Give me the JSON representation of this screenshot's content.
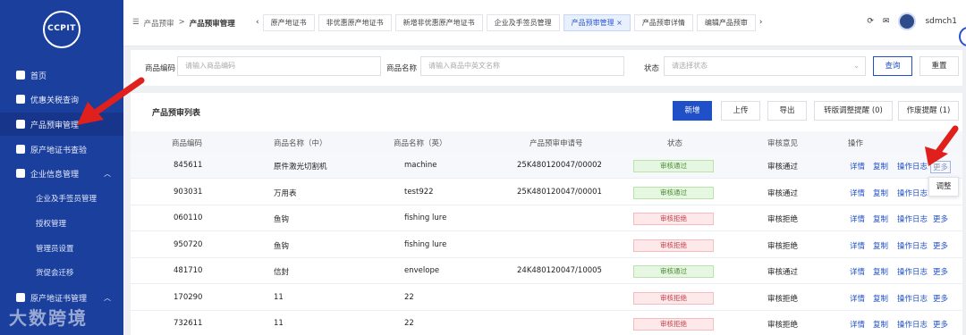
{
  "sidebar": {
    "logo_text": "CCPIT",
    "items": [
      {
        "label": "首页"
      },
      {
        "label": "优惠关税查询"
      },
      {
        "label": "产品预审管理"
      },
      {
        "label": "原产地证书查验"
      },
      {
        "label": "企业信息管理"
      },
      {
        "label": "原产地证书管理"
      }
    ],
    "sub_items": [
      "企业及手签员管理",
      "授权管理",
      "管理员设置",
      "货促会迁移"
    ]
  },
  "topbar": {
    "breadcrumb_root": "产品预审",
    "breadcrumb_sep": ">",
    "breadcrumb_current": "产品预审管理",
    "tabs": [
      "原产地证书",
      "非优惠原产地证书",
      "新增非优惠原产地证书",
      "企业及手签员管理",
      "产品预审管理",
      "产品预审详情",
      "编辑产品预审"
    ],
    "active_tab_close": "×",
    "user_name": "sdmch1"
  },
  "search": {
    "code_label": "商品编码",
    "code_placeholder": "请输入商品编码",
    "name_label": "商品名称",
    "name_placeholder": "请输入商品中英文名称",
    "status_label": "状态",
    "status_placeholder": "请选择状态",
    "query_button": "查询",
    "reset_button": "重置"
  },
  "table": {
    "title": "产品预审列表",
    "buttons": {
      "add": "新增",
      "upload": "上传",
      "export": "导出",
      "transfer": "转版调整提醒 (0)",
      "void": "作废提醒 (1)"
    },
    "headers": [
      "商品编码",
      "商品名称（中）",
      "商品名称（英）",
      "产品预审申请号",
      "状态",
      "审核意见",
      "操作"
    ],
    "ops": {
      "detail": "详情",
      "copy": "复制",
      "log": "操作日志",
      "more": "更多"
    },
    "rows": [
      {
        "code": "845611",
        "name_cn": "原件激光切割机",
        "name_en": "machine",
        "app_no": "25K480120047/00002",
        "status": "审核通过",
        "status_type": "pass",
        "opinion": "审核通过"
      },
      {
        "code": "903031",
        "name_cn": "万用表",
        "name_en": "test922",
        "app_no": "25K480120047/00001",
        "status": "审核通过",
        "status_type": "pass",
        "opinion": "审核通过"
      },
      {
        "code": "060110",
        "name_cn": "鱼钩",
        "name_en": "fishing lure",
        "app_no": "",
        "status": "审核拒绝",
        "status_type": "reject",
        "opinion": "审核拒绝"
      },
      {
        "code": "950720",
        "name_cn": "鱼钩",
        "name_en": "fishing lure",
        "app_no": "",
        "status": "审核拒绝",
        "status_type": "reject",
        "opinion": "审核拒绝"
      },
      {
        "code": "481710",
        "name_cn": "信封",
        "name_en": "envelope",
        "app_no": "24K480120047/10005",
        "status": "审核通过",
        "status_type": "pass",
        "opinion": "审核通过"
      },
      {
        "code": "170290",
        "name_cn": "11",
        "name_en": "22",
        "app_no": "",
        "status": "审核拒绝",
        "status_type": "reject",
        "opinion": "审核拒绝"
      },
      {
        "code": "732611",
        "name_cn": "11",
        "name_en": "22",
        "app_no": "",
        "status": "审核拒绝",
        "status_type": "reject",
        "opinion": "审核拒绝"
      }
    ],
    "popup_label": "调整"
  },
  "watermark": "大数跨境",
  "colors": {
    "sidebar": "#1b3f9c",
    "primary": "#2050c8",
    "annotation_arrow": "#e0201c"
  }
}
